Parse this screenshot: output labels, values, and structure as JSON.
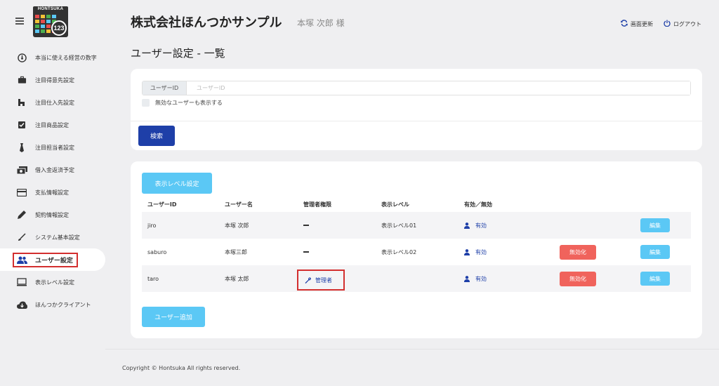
{
  "sidebar": {
    "logo_text": "HONTSUKA",
    "logo_number": "123",
    "items": [
      {
        "label": "本当に使える経営の数字",
        "icon": "speedometer-icon"
      },
      {
        "label": "注目得意先設定",
        "icon": "briefcase-icon"
      },
      {
        "label": "注目仕入先設定",
        "icon": "home-icon"
      },
      {
        "label": "注目商品設定",
        "icon": "checkbox-icon"
      },
      {
        "label": "注目担当者設定",
        "icon": "necktie-icon"
      },
      {
        "label": "借入金返済予定",
        "icon": "cash-icon"
      },
      {
        "label": "支払情報設定",
        "icon": "credit-card-icon"
      },
      {
        "label": "契約情報設定",
        "icon": "pen-icon"
      },
      {
        "label": "システム基本設定",
        "icon": "brush-icon"
      },
      {
        "label": "ユーザー設定",
        "icon": "users-icon",
        "active": true
      },
      {
        "label": "表示レベル設定",
        "icon": "monitor-icon"
      },
      {
        "label": "ほんつかクライアント",
        "icon": "cloud-download-icon"
      }
    ]
  },
  "header": {
    "company": "株式会社ほんつかサンプル",
    "user": "本塚 次郎 様",
    "refresh_label": "画面更新",
    "logout_label": "ログアウト"
  },
  "page_title": "ユーザー設定 - 一覧",
  "search": {
    "id_label": "ユーザーID",
    "id_placeholder": "ユーザーID",
    "show_inactive_label": "無効なユーザーも表示する",
    "search_button": "検索"
  },
  "list": {
    "level_button": "表示レベル設定",
    "add_button": "ユーザー追加",
    "columns": [
      "ユーザーID",
      "ユーザー名",
      "管理者権限",
      "表示レベル",
      "有効／無効"
    ],
    "rows": [
      {
        "id": "jiro",
        "name": "本塚 次郎",
        "admin": "",
        "level": "表示レベル01",
        "status": "有効",
        "disable": "",
        "edit": "編集"
      },
      {
        "id": "saburo",
        "name": "本塚三郎",
        "admin": "",
        "level": "表示レベル02",
        "status": "有効",
        "disable": "無効化",
        "edit": "編集"
      },
      {
        "id": "taro",
        "name": "本塚 太郎",
        "admin": "管理者",
        "level": "",
        "status": "有効",
        "disable": "無効化",
        "edit": "編集"
      }
    ]
  },
  "footer": "Copyright © Hontsuka All rights reserved.",
  "colors": {
    "primary": "#1e3fa8",
    "info": "#5bc8f5",
    "danger": "#f0635c",
    "highlight": "#d32f2f"
  }
}
